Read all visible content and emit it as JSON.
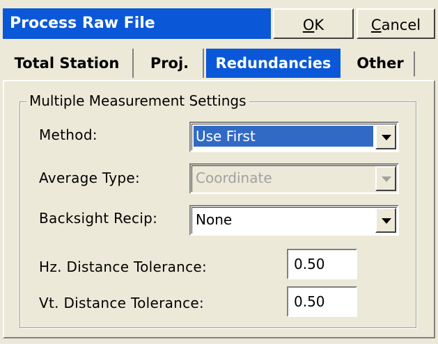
{
  "window": {
    "title": "Process Raw File",
    "ok_label_mnemonic": "O",
    "ok_label_rest": "K",
    "cancel_label_mnemonic": "C",
    "cancel_label_rest": "ancel"
  },
  "tabs": [
    {
      "label": "Total Station",
      "active": false
    },
    {
      "label": "Proj.",
      "active": false
    },
    {
      "label": "Redundancies",
      "active": true
    },
    {
      "label": "Other",
      "active": false
    }
  ],
  "group": {
    "legend": "Multiple Measurement Settings",
    "method": {
      "label": "Method:",
      "value": "Use First"
    },
    "average_type": {
      "label": "Average Type:",
      "value": "Coordinate",
      "enabled": false
    },
    "backsight_recip": {
      "label": "Backsight Recip:",
      "value": "None"
    },
    "hz_tolerance": {
      "label": "Hz. Distance Tolerance:",
      "value": "0.50"
    },
    "vt_tolerance": {
      "label": "Vt. Distance Tolerance:",
      "value": "0.50"
    }
  },
  "colors": {
    "title_bar": "#0a58d8",
    "selection": "#316ac5",
    "background": "#ece9d8"
  }
}
